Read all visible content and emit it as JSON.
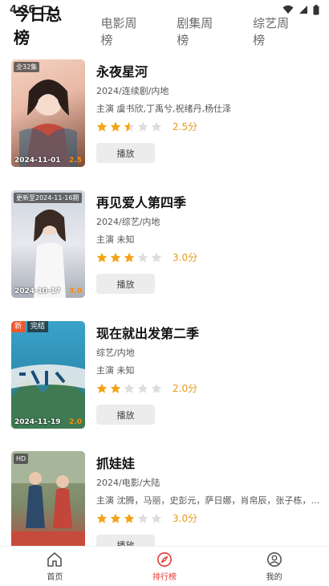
{
  "status_bar": {
    "time": "4:36"
  },
  "tabs": [
    {
      "label": "今日总榜",
      "active": true
    },
    {
      "label": "电影周榜",
      "active": false
    },
    {
      "label": "剧集周榜",
      "active": false
    },
    {
      "label": "综艺周榜",
      "active": false
    }
  ],
  "items": [
    {
      "title": "永夜星河",
      "meta": "2024/连续剧/内地",
      "cast": "主演 虞书欣,丁禹兮,祝绪丹,杨仕泽",
      "stars": 2.5,
      "score": "2.5分",
      "badge": "全32集",
      "date": "2024-11-01",
      "mini_score": "2.5",
      "play_label": "播放",
      "poster_colors": [
        "#e8b9a6",
        "#7a4a3a"
      ]
    },
    {
      "title": "再见爱人第四季",
      "meta": "2024/综艺/内地",
      "cast": "主演 未知",
      "stars": 3,
      "score": "3.0分",
      "badge": "更新至2024-11-16期",
      "date": "2024-10-17",
      "mini_score": "3.0",
      "play_label": "播放",
      "poster_colors": [
        "#d9dde6",
        "#9aa0ac"
      ]
    },
    {
      "title": "现在就出发第二季",
      "meta": "综艺/内地",
      "cast": "主演 未知",
      "stars": 2,
      "score": "2.0分",
      "badge_new": "新",
      "badge_done": "完结",
      "date": "2024-11-19",
      "mini_score": "2.0",
      "play_label": "播放",
      "poster_colors": [
        "#2f8fb3",
        "#2f6a4a"
      ]
    },
    {
      "title": "抓娃娃",
      "meta": "2024/电影/大陆",
      "cast": "主演 沈腾，马丽，史彭元，萨日娜，肖帛辰，张子栋，李嘉...",
      "stars": 3,
      "score": "3.0分",
      "badge": "HD",
      "date": "",
      "mini_score": "",
      "play_label": "播放",
      "poster_colors": [
        "#7d8a6a",
        "#b8453a"
      ]
    }
  ],
  "bottom_nav": [
    {
      "label": "首页",
      "icon": "home-icon",
      "active": false
    },
    {
      "label": "排行榜",
      "icon": "compass-icon",
      "active": true
    },
    {
      "label": "我的",
      "icon": "user-icon",
      "active": false
    }
  ],
  "colors": {
    "accent": "#e23b3b",
    "star": "#f2a316",
    "star_empty": "#dddddd",
    "score": "#e89a1c"
  }
}
